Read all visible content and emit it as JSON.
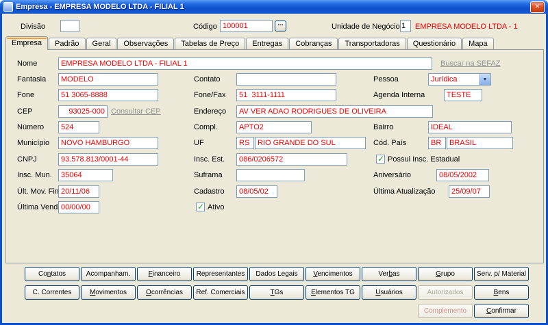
{
  "window": {
    "title": "Empresa - EMPRESA MODELO LTDA - FILIAL 1"
  },
  "icons": {
    "close": "✕",
    "dropdown": "▼",
    "check": "✓"
  },
  "header": {
    "divisao_label": "Divisão",
    "divisao_value": "",
    "codigo_label": "Código",
    "codigo_value": "100001",
    "codigo_browse": "...",
    "unidade_label": "Unidade de Negócio",
    "unidade_value": "1",
    "unidade_company": "EMPRESA MODELO LTDA - 1"
  },
  "tabs": [
    {
      "label": "Empresa"
    },
    {
      "label": "Padrão"
    },
    {
      "label": "Geral"
    },
    {
      "label": "Observações"
    },
    {
      "label": "Tabelas de Preço"
    },
    {
      "label": "Entregas"
    },
    {
      "label": "Cobranças"
    },
    {
      "label": "Transportadoras"
    },
    {
      "label": "Questionário"
    },
    {
      "label": "Mapa"
    }
  ],
  "form": {
    "nome_label": "Nome",
    "nome_value": "EMPRESA MODELO LTDA - FILIAL 1",
    "fantasia_label": "Fantasia",
    "fantasia_value": "MODELO",
    "contato_label": "Contato",
    "contato_value": "",
    "pessoa_label": "Pessoa",
    "pessoa_value": "Jurídica",
    "fone_label": "Fone",
    "fone_value": "51 3065-8888",
    "fonefax_label": "Fone/Fax",
    "fonefax_value": "51  3111-1111",
    "agenda_label": "Agenda Interna",
    "agenda_value": "TESTE",
    "cep_label": "CEP",
    "cep_value": "93025-000",
    "endereco_label": "Endereço",
    "endereco_value": "AV VER ADAO RODRIGUES DE OLIVEIRA",
    "numero_label": "Número",
    "numero_value": "524",
    "compl_label": "Compl.",
    "compl_value": "APTO2",
    "bairro_label": "Bairro",
    "bairro_value": "IDEAL",
    "municipio_label": "Município",
    "municipio_value": "NOVO HAMBURGO",
    "uf_label": "UF",
    "uf_code": "RS",
    "uf_name": "RIO GRANDE DO SUL",
    "pais_label": "Cód. País",
    "pais_code": "BR",
    "pais_name": "BRASIL",
    "cnpj_label": "CNPJ",
    "cnpj_value": "93.578.813/0001-44",
    "inscest_label": "Insc. Est.",
    "inscest_value": "086/0206572",
    "possui_insc_label": "Possui Insc. Estadual",
    "inscmun_label": "Insc. Mun.",
    "inscmun_value": "35064",
    "suframa_label": "Suframa",
    "suframa_value": "",
    "aniversario_label": "Aniversário",
    "aniversario_value": "08/05/2002",
    "ultmov_label": "Últ. Mov. Fin.",
    "ultmov_value": "20/11/06",
    "cadastro_label": "Cadastro",
    "cadastro_value": "08/05/02",
    "ultatual_label": "Última Atualização",
    "ultatual_value": "25/09/07",
    "ultvenda_label": "Última Venda",
    "ultvenda_value": "00/00/00",
    "ativo_label": "Ativo"
  },
  "links": {
    "buscar_sefaz": "Buscar na SEFAZ",
    "consultar_cep": "Consultar CEP"
  },
  "buttons": {
    "row1": [
      "Co[n]tatos",
      "Acompanham.",
      "[F]inanceiro",
      "Representantes",
      "Dados Legais",
      "[V]encimentos",
      "Ver[b]as",
      "[G]rupo",
      "Serv. p/ Material"
    ],
    "row2": [
      "C. Correntes",
      "[M]ovimentos",
      "[O]corrências",
      "Ref. Comerciais",
      "[T]Gs",
      "[E]lementos TG",
      "[U]suários",
      "Autorizados",
      "[B]ens"
    ],
    "row3": [
      "Complemento",
      "[C]onfirmar"
    ]
  }
}
